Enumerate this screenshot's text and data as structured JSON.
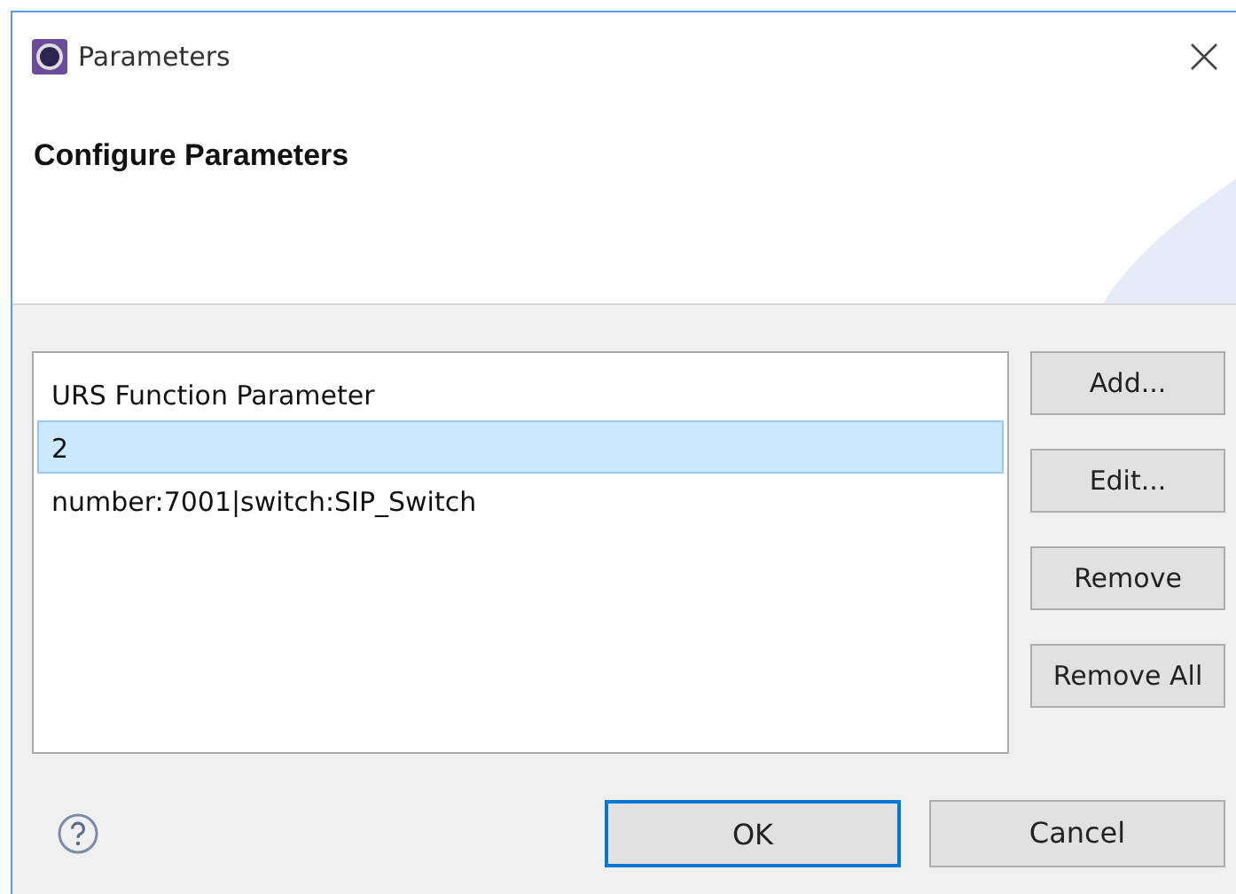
{
  "window": {
    "title": "Parameters"
  },
  "header": {
    "title": "Configure Parameters"
  },
  "list": {
    "items": [
      {
        "text": "URS Function Parameter",
        "selected": false
      },
      {
        "text": "2",
        "selected": true
      },
      {
        "text": "number:7001|switch:SIP_Switch",
        "selected": false
      }
    ]
  },
  "side_buttons": [
    "Add...",
    "Edit...",
    "Remove",
    "Remove All"
  ],
  "footer": {
    "buttons": [
      {
        "label": "OK",
        "default": true
      },
      {
        "label": "Cancel",
        "default": false
      }
    ]
  }
}
